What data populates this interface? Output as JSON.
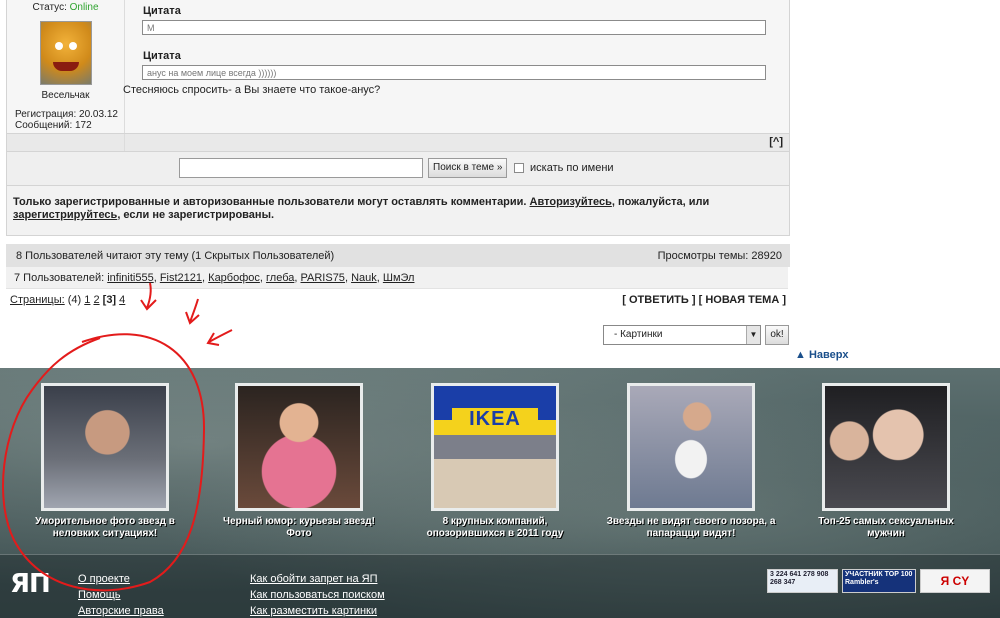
{
  "post": {
    "status_label": "Статус:",
    "status_value": "Online",
    "username": "Весельчак",
    "registration": "Регистрация: 20.03.12",
    "messages": "Сообщений: 172",
    "quotes": [
      {
        "title": "Цитата",
        "text": "М"
      },
      {
        "title": "Цитата",
        "text": "анус на моем лице всегда ))))))"
      }
    ],
    "text": "Стесняюсь спросить- а Вы знаете что такое-анус?",
    "scroll_top_label": "[^]"
  },
  "search": {
    "button_label": "Поиск в теме »",
    "checkbox_label": "искать по имени"
  },
  "notice": {
    "part1": "Только зарегистрированные и авторизованные пользователи могут оставлять комментарии. ",
    "login_link": "Авторизуйтесь",
    "part2": ", пожалуйста, или ",
    "register_link": "зарегистрируйтесь",
    "part3": ", если не зарегистрированы."
  },
  "readers": {
    "summary": "8 Пользователей читают эту тему (1 Скрытых Пользователей)",
    "views": "Просмотры темы: 28920",
    "list_label": "7 Пользователей:",
    "users": [
      "infiniti555",
      "Fist2121",
      "Карбофос",
      "глеба",
      "PARIS75",
      "Nauk",
      "ШмЭл"
    ]
  },
  "pagination": {
    "label": "Страницы:",
    "count": "(4)",
    "pages": [
      "1",
      "2"
    ],
    "current": "[3]",
    "last": "4",
    "reply": "[ ОТВЕТИТЬ ]",
    "new_topic": "[ НОВАЯ ТЕМА ]"
  },
  "jump": {
    "selected": "- Картинки",
    "ok_label": "ok!",
    "top_link": "Наверх"
  },
  "promo": [
    {
      "caption": "Уморительное фото звезд в неловких ситуациях!"
    },
    {
      "caption": "Черный юмор: курьезы звезд! Фото"
    },
    {
      "caption": "8 крупных компаний, опозорившихся в 2011 году",
      "thumb_text": "IKEA"
    },
    {
      "caption": "Звезды не видят своего позора, а папарацци видят!"
    },
    {
      "caption": "Топ-25 самых сексуальных мужчин"
    }
  ],
  "footer": {
    "logo": "ЯП",
    "col1": [
      "О проекте",
      "Помощь",
      "Авторские права"
    ],
    "col2": [
      "Как обойти запрет на ЯП",
      "Как пользоваться поиском",
      "Как разместить картинки"
    ],
    "badges": [
      "3 224 641 278 908 268 347",
      "УЧАСТНИК TOP 100 Rambler's",
      "Я CY"
    ]
  },
  "colors": {
    "online": "#2fa32f",
    "link_blue": "#1a4f8b",
    "annotation_red": "#e31b1b"
  }
}
